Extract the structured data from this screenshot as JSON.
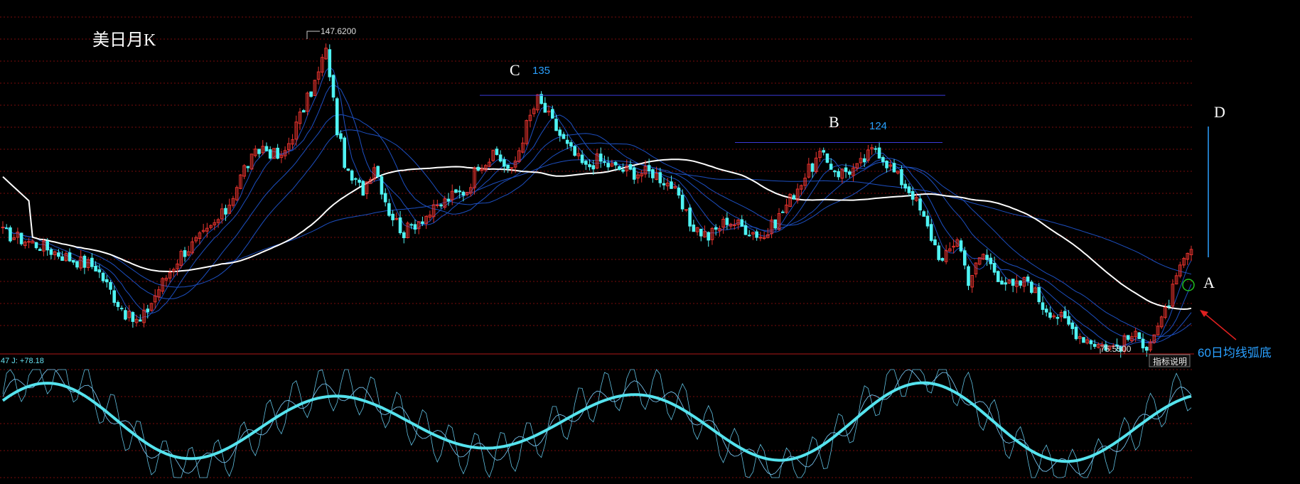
{
  "title": "美日月K",
  "colors": {
    "background": "#000000",
    "grid": "#7a0d0d",
    "up": "#e8332e",
    "down": "#4ff3f3",
    "ma60": "#ffffff",
    "ma_thin": "#1d4fc0",
    "annotation": "#2aa0ff",
    "arrow": "#e02020",
    "circle": "#22c022",
    "kdj_main": "#55e3ee"
  },
  "chart_data": [
    {
      "type": "candlestick",
      "title": "美日月K",
      "xlabel": "",
      "ylabel": "",
      "ylim": [
        75,
        150
      ],
      "grid": true,
      "high_label": "147.6200",
      "low_label": "75.5500",
      "high": 147.62,
      "low": 75.55,
      "levels": [
        {
          "label": "C",
          "value": 135,
          "value_label": "135"
        },
        {
          "label": "B",
          "value": 124,
          "value_label": "124"
        }
      ],
      "points": [
        {
          "label": "A"
        },
        {
          "label": "D"
        }
      ],
      "annotations": [
        "60日均线弧底"
      ],
      "moving_averages": [
        {
          "name": "MA60",
          "color": "#ffffff"
        }
      ]
    },
    {
      "type": "line",
      "title": "",
      "ylim": [
        0,
        100
      ],
      "legend_text": "47 J: +78.18",
      "series": [
        {
          "name": "J",
          "last": 78.18
        }
      ]
    }
  ],
  "button": {
    "label": "指标说明"
  }
}
